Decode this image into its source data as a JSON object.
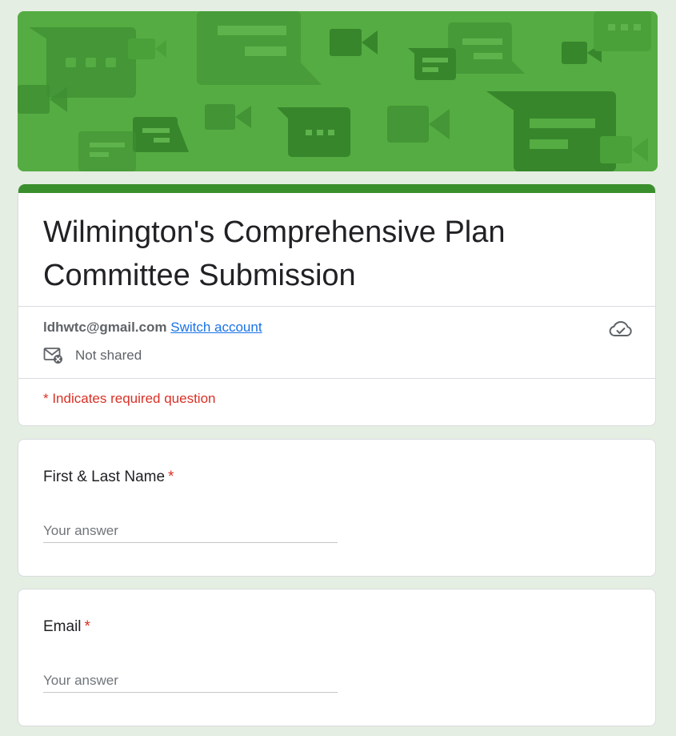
{
  "form": {
    "title": "Wilmington's Comprehensive Plan Committee Submission",
    "account_email": "ldhwtc@gmail.com",
    "switch_account_label": "Switch account",
    "shared_status": "Not shared",
    "required_note": "* Indicates required question"
  },
  "questions": [
    {
      "label": "First & Last Name",
      "required_marker": "*",
      "placeholder": "Your answer"
    },
    {
      "label": "Email",
      "required_marker": "*",
      "placeholder": "Your answer"
    }
  ],
  "colors": {
    "banner": "#55ac42",
    "accent": "#3a8f2d",
    "background": "#e4eee2",
    "required": "#d93025",
    "link": "#1a73e8"
  },
  "icons": {
    "cloud": "cloud-check-icon",
    "mail": "mail-not-shared-icon"
  }
}
